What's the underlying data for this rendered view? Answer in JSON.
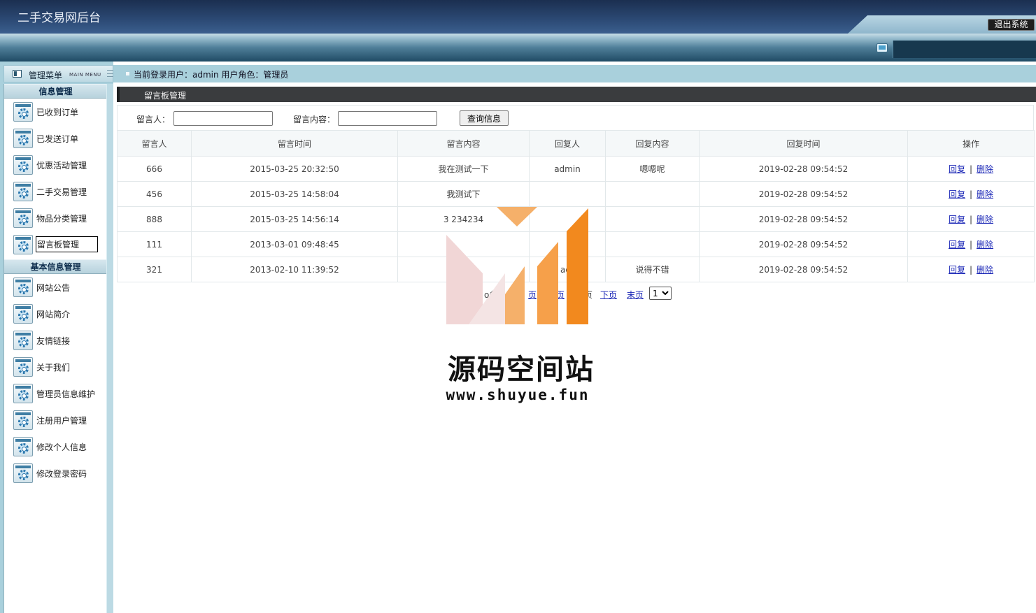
{
  "header": {
    "title": "二手交易网后台",
    "logout_label": "退出系统"
  },
  "left_panel": {
    "title": "管理菜单",
    "subtitle": "MAIN MENU"
  },
  "menu": {
    "sections": [
      {
        "title": "信息管理",
        "items": [
          {
            "label": "已收到订单"
          },
          {
            "label": "已发送订单"
          },
          {
            "label": "优惠活动管理"
          },
          {
            "label": "二手交易管理"
          },
          {
            "label": "物品分类管理"
          },
          {
            "label": "留言板管理"
          }
        ]
      },
      {
        "title": "基本信息管理",
        "items": [
          {
            "label": "网站公告"
          },
          {
            "label": "网站简介"
          },
          {
            "label": "友情链接"
          },
          {
            "label": "关于我们"
          },
          {
            "label": "管理员信息维护"
          },
          {
            "label": "注册用户管理"
          },
          {
            "label": "修改个人信息"
          },
          {
            "label": "修改登录密码"
          }
        ]
      }
    ]
  },
  "status": {
    "text": "当前登录用户：admin  用户角色：管理员"
  },
  "main": {
    "title": "留言板管理",
    "search": {
      "author_label": "留言人：",
      "author_value": "",
      "content_label": "留言内容：",
      "content_value": "",
      "button_label": "查询信息"
    },
    "table": {
      "columns": [
        "留言人",
        "留言时间",
        "留言内容",
        "回复人",
        "回复内容",
        "回复时间",
        "操作"
      ],
      "rows": [
        {
          "author": "666",
          "time": "2015-03-25 20:32:50",
          "content": "我在测试一下",
          "replier": "admin",
          "reply": "嗯嗯呢",
          "reply_time": "2019-02-28 09:54:52"
        },
        {
          "author": "456",
          "time": "2015-03-25 14:58:04",
          "content": "我测试下",
          "replier": "",
          "reply": "",
          "reply_time": "2019-02-28 09:54:52"
        },
        {
          "author": "888",
          "time": "2015-03-25 14:56:14",
          "content": "3 234234",
          "replier": "",
          "reply": "",
          "reply_time": "2019-02-28 09:54:52"
        },
        {
          "author": "111",
          "time": "2013-03-01 09:48:45",
          "content": "",
          "replier": "",
          "reply": "",
          "reply_time": "2019-02-28 09:54:52"
        },
        {
          "author": "321",
          "time": "2013-02-10 11:39:52",
          "content": "3",
          "replier": "adr",
          "reply": "说得不错",
          "reply_time": "2019-02-28 09:54:52"
        }
      ],
      "op_reply": "回复",
      "op_delete": "删除",
      "op_sep": "|"
    },
    "pager": {
      "total": "o条",
      "first": "页",
      "prev": "页",
      "current": "页",
      "next": "下页",
      "last": "末页",
      "page_selected": "1"
    }
  },
  "watermark": {
    "brand": "源码空间站",
    "url": "www.shuyue.fun",
    "colors": {
      "orange": "#f2891e",
      "light_orange": "#f5b06a",
      "pink": "#f1d6d6"
    }
  },
  "colors": {
    "header_dark": "#1b2f50",
    "menu_bg": "#a9d0dc",
    "title_bar": "#3a3c3e",
    "link": "#1a26b6"
  }
}
